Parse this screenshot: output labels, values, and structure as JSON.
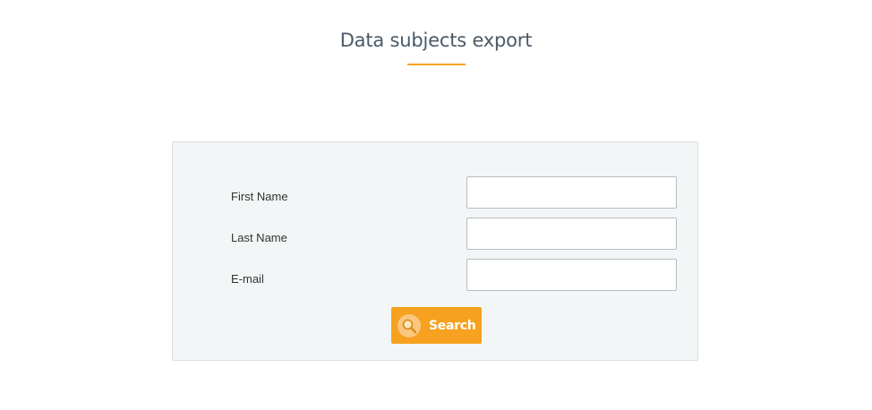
{
  "page": {
    "title": "Data subjects export"
  },
  "form": {
    "fields": [
      {
        "label": "First Name",
        "value": "",
        "placeholder": ""
      },
      {
        "label": "Last Name",
        "value": "",
        "placeholder": ""
      },
      {
        "label": "E-mail",
        "value": "",
        "placeholder": ""
      }
    ],
    "search_label": "Search",
    "search_icon": "magnifier-icon"
  },
  "colors": {
    "accent": "#f6a11f",
    "title_text": "#4a5a68",
    "panel_background": "#f3f6f7"
  }
}
